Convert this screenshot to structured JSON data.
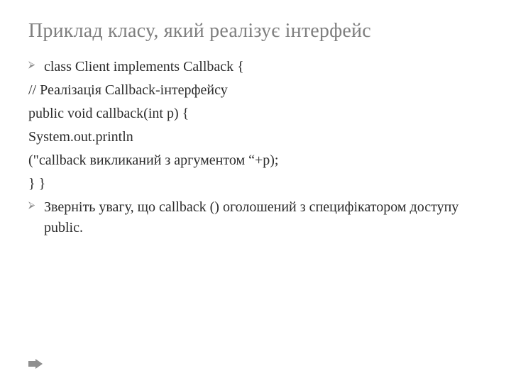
{
  "title": "Приклад класу, який реалізує інтерфейс",
  "code": {
    "l1": "class Client implements Callback  {",
    "l2": "// Реалізація Callback-інтерфейсу",
    "l3": "public void callback(int p)   {",
    "l4": "System.out.println",
    "l5": "(\"callback викликаний з аргументом “+p);",
    "l6": "} }"
  },
  "note": "Зверніть увагу, що callback () оголошений з специфікатором доступу public.",
  "bullet_glyph": "⮚"
}
